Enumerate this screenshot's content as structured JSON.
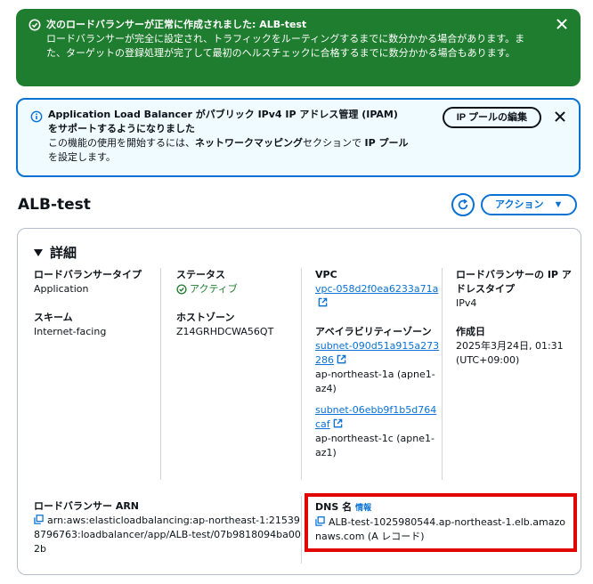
{
  "success_flash": {
    "title": "次のロードバランサーが正常に作成されました: ALB-test",
    "message": "ロードバランサーが完全に設定され、トラフィックをルーティングするまでに数分かかる場合があります。また、ターゲットの登録処理が完了して最初のヘルスチェックに合格するまでに数分かかる場合もあります。"
  },
  "info_flash": {
    "title": "Application Load Balancer がパブリック IPv4 IP アドレス管理 (IPAM) をサポートするようになりました",
    "message_prefix": "この機能の使用を開始するには、",
    "message_bold": "ネットワークマッピング",
    "message_mid": "セクションで ",
    "message_bold2": "IP プール",
    "message_suffix": "を設定します。",
    "button_label": "IP プールの編集"
  },
  "header": {
    "title": "ALB-test",
    "action_label": "アクション"
  },
  "details": {
    "section_title": "詳細",
    "lb_type_label": "ロードバランサータイプ",
    "lb_type_value": "Application",
    "scheme_label": "スキーム",
    "scheme_value": "Internet-facing",
    "status_label": "ステータス",
    "status_value": "アクティブ",
    "hosted_zone_label": "ホストゾーン",
    "hosted_zone_value": "Z14GRHDCWA56QT",
    "vpc_label": "VPC",
    "vpc_value": "vpc-058d2f0ea6233a71a",
    "az_label": "アベイラビリティーゾーン",
    "subnet1": "subnet-090d51a915a273286",
    "subnet1_az": "ap-northeast-1a (apne1-az4)",
    "subnet2": "subnet-06ebb9f1b5d764caf",
    "subnet2_az": "ap-northeast-1c (apne1-az1)",
    "ip_type_label": "ロードバランサーの IP アドレスタイプ",
    "ip_type_value": "IPv4",
    "created_label": "作成日",
    "created_value": "2025年3月24日, 01:31 (UTC+09:00)",
    "arn_label": "ロードバランサー ARN",
    "arn_value": "arn:aws:elasticloadbalancing:ap-northeast-1:215398796763:loadbalancer/app/ALB-test/07b9818094ba002b",
    "dns_label": "DNS 名",
    "dns_info": "情報",
    "dns_value": "ALB-test-1025980544.ap-northeast-1.elb.amazonaws.com (A レコード)"
  },
  "colors": {
    "success": "#1f7d2f",
    "info_border": "#0972d3",
    "link": "#0972d3",
    "highlight": "#e10600"
  }
}
